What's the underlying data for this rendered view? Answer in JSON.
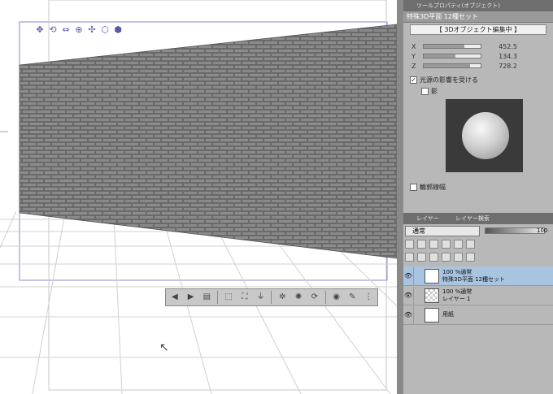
{
  "toolbar3d": {
    "icons": [
      "move-icon",
      "rotate-icon",
      "pan-icon",
      "camera-rotate-icon",
      "translate-icon",
      "object-rotate-icon",
      "object-pan-icon"
    ]
  },
  "floatbar": {
    "icons": [
      "prev-icon",
      "next-icon",
      "list-icon",
      "load-icon",
      "fit-icon",
      "ground-icon",
      "mat-icon",
      "scale-icon",
      "reset-icon",
      "light-icon",
      "pose-icon",
      "more-icon"
    ]
  },
  "panel": {
    "tab_title": "ツールプロパティ(オブジェクト)",
    "object_title": "特殊3D平面 12種セット",
    "banner": "【 3Dオブジェクト編集中 】",
    "props": [
      {
        "label": "X",
        "value": "452.5",
        "fill": 0.72
      },
      {
        "label": "Y",
        "value": "134.3",
        "fill": 0.55
      },
      {
        "label": "Z",
        "value": "728.2",
        "fill": 0.82
      }
    ],
    "light_label": "光源の影響を受ける",
    "shadow_label": "影",
    "outline_label": "輪郭線幅"
  },
  "layer_panel": {
    "tab_title": "レイヤー",
    "tab2": "レイヤー検索",
    "blend_mode": "通常",
    "opacity": "100",
    "layers": [
      {
        "line1": "100 %通常",
        "line2": "特殊3D平面 12種セット",
        "selected": true
      },
      {
        "line1": "100 %通常",
        "line2": "レイヤー 1",
        "selected": false
      },
      {
        "line1": "",
        "line2": "用紙",
        "selected": false
      }
    ]
  }
}
